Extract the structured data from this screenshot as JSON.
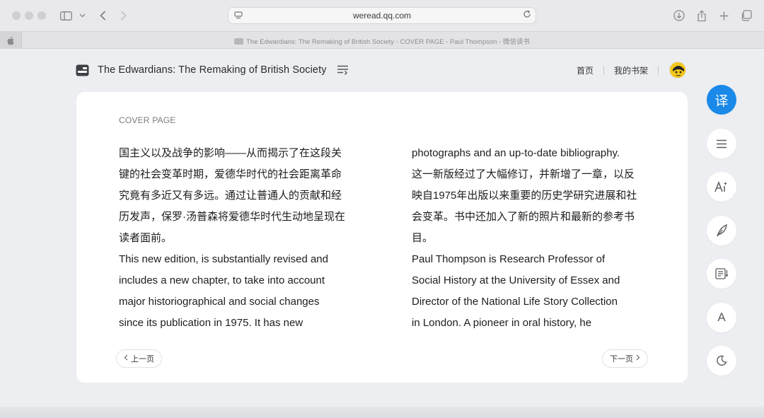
{
  "browser": {
    "url": "weread.qq.com",
    "tab_title": "The Edwardians: The Remaking of British Society - COVER PAGE - Paul Thompson - 微信读书"
  },
  "header": {
    "book_title": "The Edwardians: The Remaking of British Society",
    "nav": {
      "home": "首页",
      "bookshelf": "我的书架"
    }
  },
  "reader": {
    "section": "COVER PAGE",
    "left_lines": [
      "国主义以及战争的影响——从而揭示了在这段关",
      "键的社会变革时期，爱德华时代的社会距离革命",
      "究竟有多近又有多远。通过让普通人的贡献和经",
      "历发声，保罗·汤普森将爱德华时代生动地呈现在",
      "读者面前。",
      "This new edition, is substantially revised and",
      "includes a new chapter, to take into account",
      "major historiographical and social changes",
      "since its publication in 1975. It has new"
    ],
    "right_lines": [
      "photographs and an up-to-date bibliography.",
      "这一新版经过了大幅修订，并新增了一章，以反",
      "映自1975年出版以来重要的历史学研究进展和社",
      "会变革。书中还加入了新的照片和最新的参考书",
      "目。",
      "Paul Thompson is Research Professor of",
      "Social History at the University of Essex and",
      "Director of the National Life Story Collection",
      "in London. A pioneer in oral history, he"
    ],
    "prev_label": "上一页",
    "next_label": "下一页"
  },
  "sidebar": {
    "translate_label": "译",
    "font_label": "A"
  },
  "colors": {
    "accent": "#1a89e8",
    "page_bg": "#edeef1",
    "card_bg": "#ffffff"
  }
}
